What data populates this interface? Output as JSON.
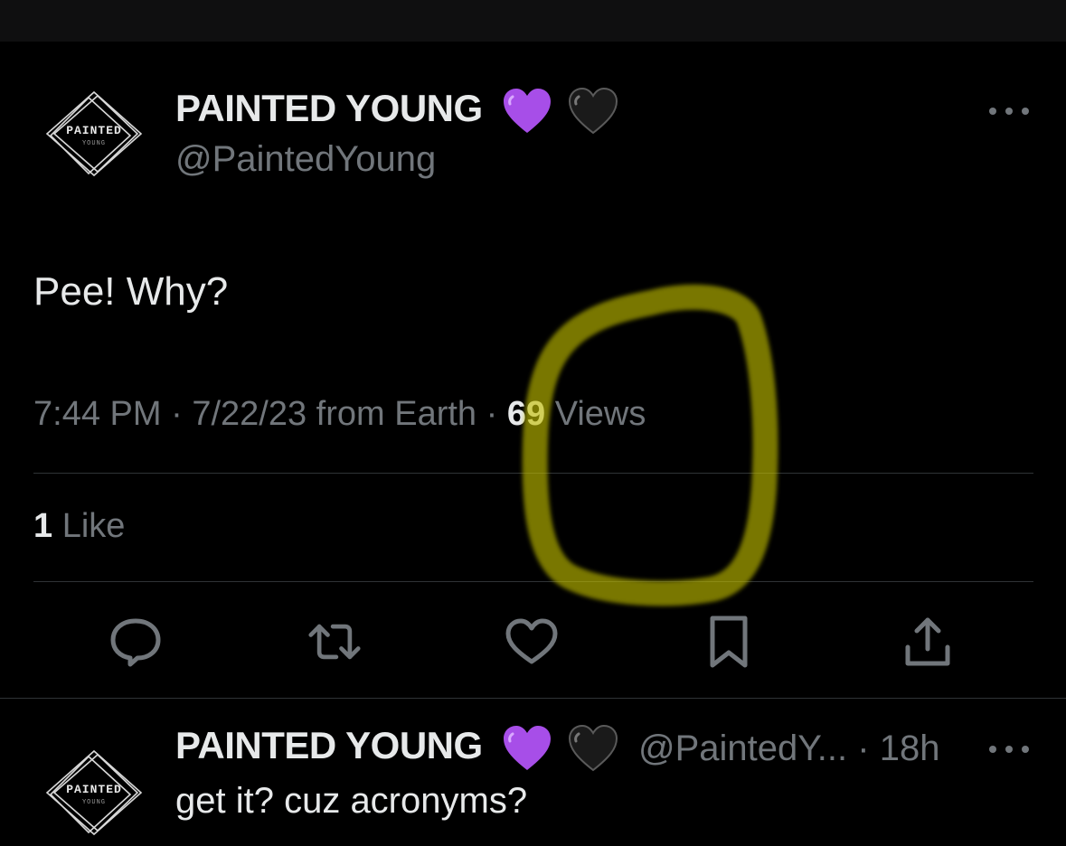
{
  "tweet": {
    "display_name": "PAINTED YOUNG",
    "handle": "@PaintedYoung",
    "text": "Pee! Why?",
    "time": "7:44 PM",
    "date": "7/22/23",
    "source": "from Earth",
    "separator": "·",
    "views_count": "69",
    "views_label": "Views",
    "likes_count": "1",
    "likes_label": "Like",
    "avatar_text": "PAINTED",
    "avatar_subtext": "YOUNG"
  },
  "actions": [
    {
      "name": "reply",
      "icon": "reply-icon"
    },
    {
      "name": "retweet",
      "icon": "retweet-icon"
    },
    {
      "name": "like",
      "icon": "heart-icon"
    },
    {
      "name": "bookmark",
      "icon": "bookmark-icon"
    },
    {
      "name": "share",
      "icon": "share-icon"
    }
  ],
  "reply": {
    "display_name": "PAINTED YOUNG",
    "handle": "@PaintedY...",
    "separator": "·",
    "time": "18h",
    "text": "get it? cuz acronyms?"
  },
  "emoji": [
    "purple-heart",
    "black-heart"
  ],
  "colors": {
    "background": "#000000",
    "text_primary": "#e7e9ea",
    "text_secondary": "#71767b",
    "divider": "#2f3336",
    "purple_heart": "#a74ee8",
    "highlight": "#c4c000"
  }
}
